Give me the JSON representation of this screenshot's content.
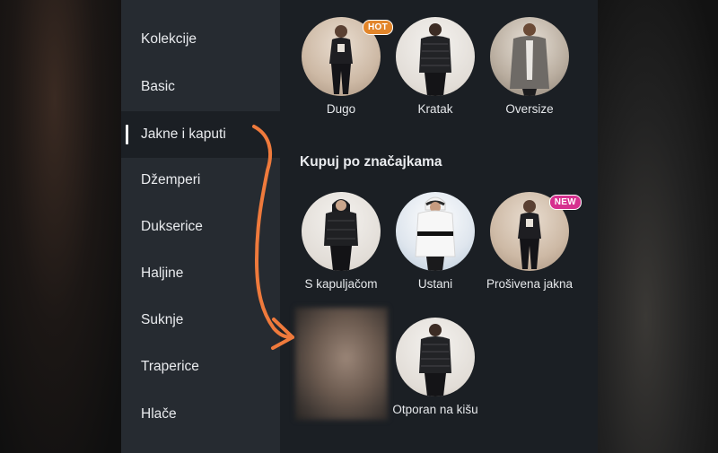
{
  "sidebar": {
    "items": [
      {
        "label": "Kolekcije",
        "active": false
      },
      {
        "label": "Basic",
        "active": false
      },
      {
        "label": "Jakne i kaputi",
        "active": true
      },
      {
        "label": "Džemperi",
        "active": false
      },
      {
        "label": "Dukserice",
        "active": false
      },
      {
        "label": "Haljine",
        "active": false
      },
      {
        "label": "Suknje",
        "active": false
      },
      {
        "label": "Traperice",
        "active": false
      },
      {
        "label": "Hlače",
        "active": false
      }
    ]
  },
  "content": {
    "length_cards": [
      {
        "label": "Dugo",
        "badge": "HOT"
      },
      {
        "label": "Kratak",
        "badge": ""
      },
      {
        "label": "Oversize",
        "badge": ""
      }
    ],
    "features_title": "Kupuj po značajkama",
    "feature_cards": [
      {
        "label": "S kapuljačom",
        "badge": ""
      },
      {
        "label": "Ustani",
        "badge": ""
      },
      {
        "label": "Prošivena jakna",
        "badge": "NEW"
      },
      {
        "label": "Otporan na kišu",
        "badge": ""
      }
    ]
  },
  "colors": {
    "sidebar_bg": "#262b31",
    "content_bg": "#1b1f24",
    "hot_badge": "#e2852a",
    "new_badge": "#d6318f",
    "annotation_arrow": "#ef7a3c"
  },
  "icons": [
    "hot-badge",
    "new-badge",
    "hand-drawn-arrow"
  ]
}
